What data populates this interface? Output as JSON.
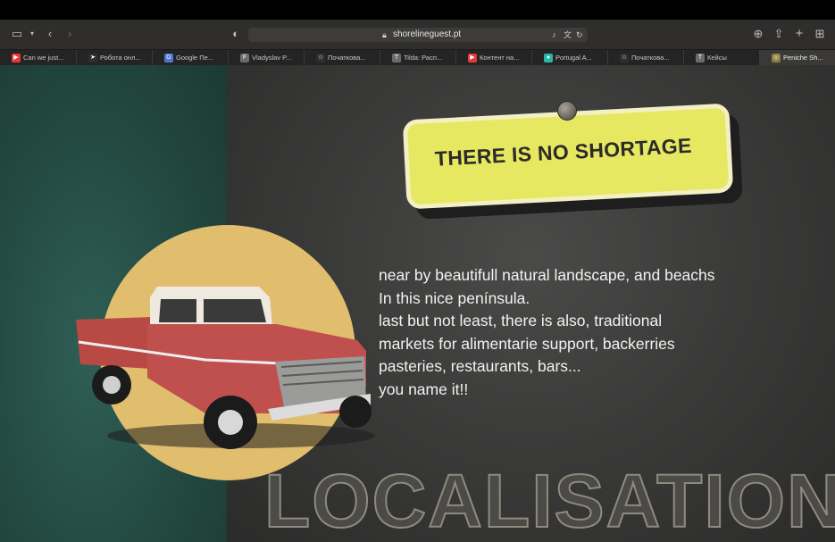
{
  "browser": {
    "url": "shorelineguest.pt",
    "tabs": [
      {
        "label": "Can we just...",
        "favicon_color": "#e53935",
        "favicon_glyph": "▶"
      },
      {
        "label": "Робота онл...",
        "favicon_color": "#2f2e2d",
        "favicon_glyph": "➤"
      },
      {
        "label": "Google Пе...",
        "favicon_color": "#4a78d6",
        "favicon_glyph": "G"
      },
      {
        "label": "Vladyslav P...",
        "favicon_color": "#6b6b6b",
        "favicon_glyph": "F"
      },
      {
        "label": "Початкова...",
        "favicon_color": "#2f2e2d",
        "favicon_glyph": "☆"
      },
      {
        "label": "Tilda: Расп...",
        "favicon_color": "#6b6b6b",
        "favicon_glyph": "T"
      },
      {
        "label": "Контент на...",
        "favicon_color": "#e53935",
        "favicon_glyph": "▶"
      },
      {
        "label": "Portugal A...",
        "favicon_color": "#2ab5a5",
        "favicon_glyph": "●"
      },
      {
        "label": "Початкова...",
        "favicon_color": "#2f2e2d",
        "favicon_glyph": "☆"
      },
      {
        "label": "Кейсы",
        "favicon_color": "#6b6b6b",
        "favicon_glyph": "T"
      },
      {
        "label": "Peniche Sh...",
        "favicon_color": "#8a7d3a",
        "favicon_glyph": "◎"
      }
    ]
  },
  "page": {
    "sign_text": "THERE IS NO SHORTAGE",
    "paragraph": [
      "near by beautifull natural landscape, and beachs",
      "In this nice península.",
      "last but not least, there is also, traditional",
      "markets for alimentarie support, backerries",
      "pasteries, restaurants, bars...",
      "you name it!!"
    ],
    "section_title": "LOCALISATION"
  },
  "colors": {
    "teal_panel": "#234941",
    "chalkboard": "#3b3b3a",
    "sun": "#e0be6e",
    "sign": "#e6e861",
    "truck_body": "#c0504d"
  }
}
